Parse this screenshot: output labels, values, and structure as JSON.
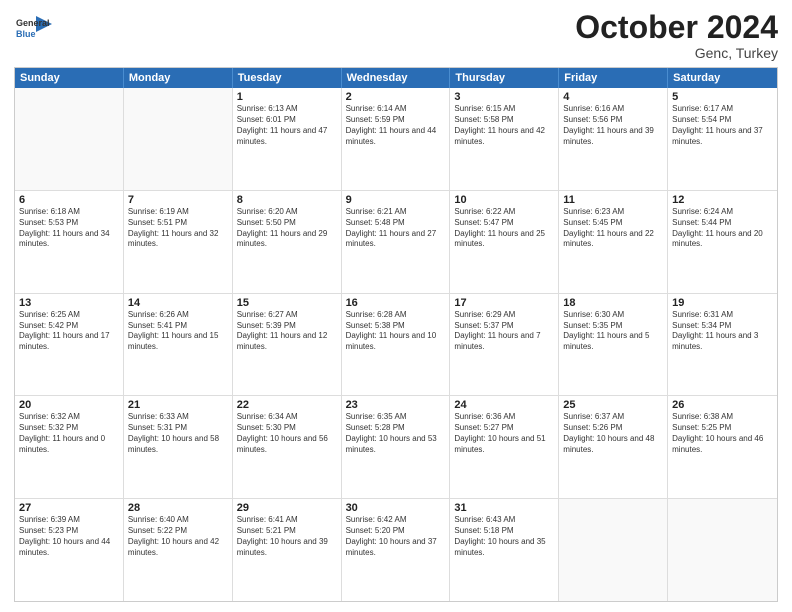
{
  "header": {
    "logo_general": "General",
    "logo_blue": "Blue",
    "month_title": "October 2024",
    "location": "Genc, Turkey"
  },
  "days_of_week": [
    "Sunday",
    "Monday",
    "Tuesday",
    "Wednesday",
    "Thursday",
    "Friday",
    "Saturday"
  ],
  "weeks": [
    [
      {
        "day": "",
        "empty": true
      },
      {
        "day": "",
        "empty": true
      },
      {
        "day": "1",
        "sunrise": "Sunrise: 6:13 AM",
        "sunset": "Sunset: 6:01 PM",
        "daylight": "Daylight: 11 hours and 47 minutes."
      },
      {
        "day": "2",
        "sunrise": "Sunrise: 6:14 AM",
        "sunset": "Sunset: 5:59 PM",
        "daylight": "Daylight: 11 hours and 44 minutes."
      },
      {
        "day": "3",
        "sunrise": "Sunrise: 6:15 AM",
        "sunset": "Sunset: 5:58 PM",
        "daylight": "Daylight: 11 hours and 42 minutes."
      },
      {
        "day": "4",
        "sunrise": "Sunrise: 6:16 AM",
        "sunset": "Sunset: 5:56 PM",
        "daylight": "Daylight: 11 hours and 39 minutes."
      },
      {
        "day": "5",
        "sunrise": "Sunrise: 6:17 AM",
        "sunset": "Sunset: 5:54 PM",
        "daylight": "Daylight: 11 hours and 37 minutes."
      }
    ],
    [
      {
        "day": "6",
        "sunrise": "Sunrise: 6:18 AM",
        "sunset": "Sunset: 5:53 PM",
        "daylight": "Daylight: 11 hours and 34 minutes."
      },
      {
        "day": "7",
        "sunrise": "Sunrise: 6:19 AM",
        "sunset": "Sunset: 5:51 PM",
        "daylight": "Daylight: 11 hours and 32 minutes."
      },
      {
        "day": "8",
        "sunrise": "Sunrise: 6:20 AM",
        "sunset": "Sunset: 5:50 PM",
        "daylight": "Daylight: 11 hours and 29 minutes."
      },
      {
        "day": "9",
        "sunrise": "Sunrise: 6:21 AM",
        "sunset": "Sunset: 5:48 PM",
        "daylight": "Daylight: 11 hours and 27 minutes."
      },
      {
        "day": "10",
        "sunrise": "Sunrise: 6:22 AM",
        "sunset": "Sunset: 5:47 PM",
        "daylight": "Daylight: 11 hours and 25 minutes."
      },
      {
        "day": "11",
        "sunrise": "Sunrise: 6:23 AM",
        "sunset": "Sunset: 5:45 PM",
        "daylight": "Daylight: 11 hours and 22 minutes."
      },
      {
        "day": "12",
        "sunrise": "Sunrise: 6:24 AM",
        "sunset": "Sunset: 5:44 PM",
        "daylight": "Daylight: 11 hours and 20 minutes."
      }
    ],
    [
      {
        "day": "13",
        "sunrise": "Sunrise: 6:25 AM",
        "sunset": "Sunset: 5:42 PM",
        "daylight": "Daylight: 11 hours and 17 minutes."
      },
      {
        "day": "14",
        "sunrise": "Sunrise: 6:26 AM",
        "sunset": "Sunset: 5:41 PM",
        "daylight": "Daylight: 11 hours and 15 minutes."
      },
      {
        "day": "15",
        "sunrise": "Sunrise: 6:27 AM",
        "sunset": "Sunset: 5:39 PM",
        "daylight": "Daylight: 11 hours and 12 minutes."
      },
      {
        "day": "16",
        "sunrise": "Sunrise: 6:28 AM",
        "sunset": "Sunset: 5:38 PM",
        "daylight": "Daylight: 11 hours and 10 minutes."
      },
      {
        "day": "17",
        "sunrise": "Sunrise: 6:29 AM",
        "sunset": "Sunset: 5:37 PM",
        "daylight": "Daylight: 11 hours and 7 minutes."
      },
      {
        "day": "18",
        "sunrise": "Sunrise: 6:30 AM",
        "sunset": "Sunset: 5:35 PM",
        "daylight": "Daylight: 11 hours and 5 minutes."
      },
      {
        "day": "19",
        "sunrise": "Sunrise: 6:31 AM",
        "sunset": "Sunset: 5:34 PM",
        "daylight": "Daylight: 11 hours and 3 minutes."
      }
    ],
    [
      {
        "day": "20",
        "sunrise": "Sunrise: 6:32 AM",
        "sunset": "Sunset: 5:32 PM",
        "daylight": "Daylight: 11 hours and 0 minutes."
      },
      {
        "day": "21",
        "sunrise": "Sunrise: 6:33 AM",
        "sunset": "Sunset: 5:31 PM",
        "daylight": "Daylight: 10 hours and 58 minutes."
      },
      {
        "day": "22",
        "sunrise": "Sunrise: 6:34 AM",
        "sunset": "Sunset: 5:30 PM",
        "daylight": "Daylight: 10 hours and 56 minutes."
      },
      {
        "day": "23",
        "sunrise": "Sunrise: 6:35 AM",
        "sunset": "Sunset: 5:28 PM",
        "daylight": "Daylight: 10 hours and 53 minutes."
      },
      {
        "day": "24",
        "sunrise": "Sunrise: 6:36 AM",
        "sunset": "Sunset: 5:27 PM",
        "daylight": "Daylight: 10 hours and 51 minutes."
      },
      {
        "day": "25",
        "sunrise": "Sunrise: 6:37 AM",
        "sunset": "Sunset: 5:26 PM",
        "daylight": "Daylight: 10 hours and 48 minutes."
      },
      {
        "day": "26",
        "sunrise": "Sunrise: 6:38 AM",
        "sunset": "Sunset: 5:25 PM",
        "daylight": "Daylight: 10 hours and 46 minutes."
      }
    ],
    [
      {
        "day": "27",
        "sunrise": "Sunrise: 6:39 AM",
        "sunset": "Sunset: 5:23 PM",
        "daylight": "Daylight: 10 hours and 44 minutes."
      },
      {
        "day": "28",
        "sunrise": "Sunrise: 6:40 AM",
        "sunset": "Sunset: 5:22 PM",
        "daylight": "Daylight: 10 hours and 42 minutes."
      },
      {
        "day": "29",
        "sunrise": "Sunrise: 6:41 AM",
        "sunset": "Sunset: 5:21 PM",
        "daylight": "Daylight: 10 hours and 39 minutes."
      },
      {
        "day": "30",
        "sunrise": "Sunrise: 6:42 AM",
        "sunset": "Sunset: 5:20 PM",
        "daylight": "Daylight: 10 hours and 37 minutes."
      },
      {
        "day": "31",
        "sunrise": "Sunrise: 6:43 AM",
        "sunset": "Sunset: 5:18 PM",
        "daylight": "Daylight: 10 hours and 35 minutes."
      },
      {
        "day": "",
        "empty": true
      },
      {
        "day": "",
        "empty": true
      }
    ]
  ]
}
